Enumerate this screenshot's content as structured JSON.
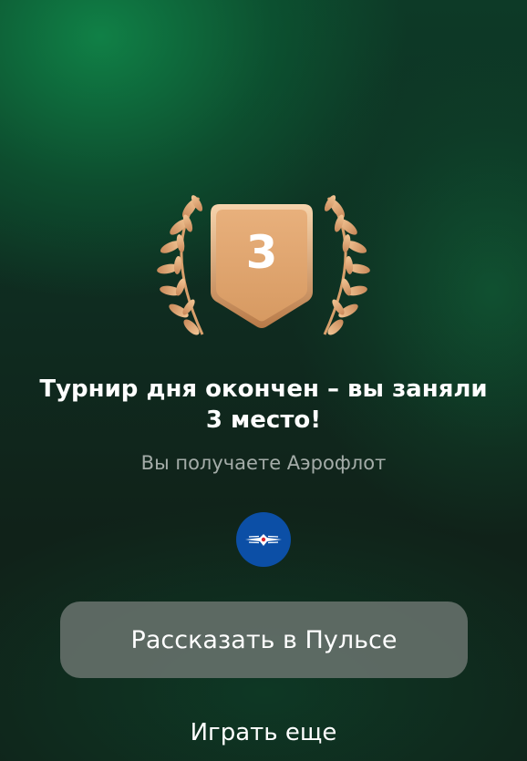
{
  "result": {
    "place": "3",
    "title": "Турнир дня окончен – вы заняли 3 место!",
    "subtitle": "Вы получаете Аэрофлот"
  },
  "reward": {
    "icon": "aeroflot-logo-icon",
    "color": "#0c4fa6"
  },
  "actions": {
    "share_label": "Рассказать в Пульсе",
    "play_again_label": "Играть еще"
  },
  "colors": {
    "badge_gold": "#e0a36a",
    "laurel_gold": "#e6b07a",
    "button_bg": "#6e7672"
  }
}
